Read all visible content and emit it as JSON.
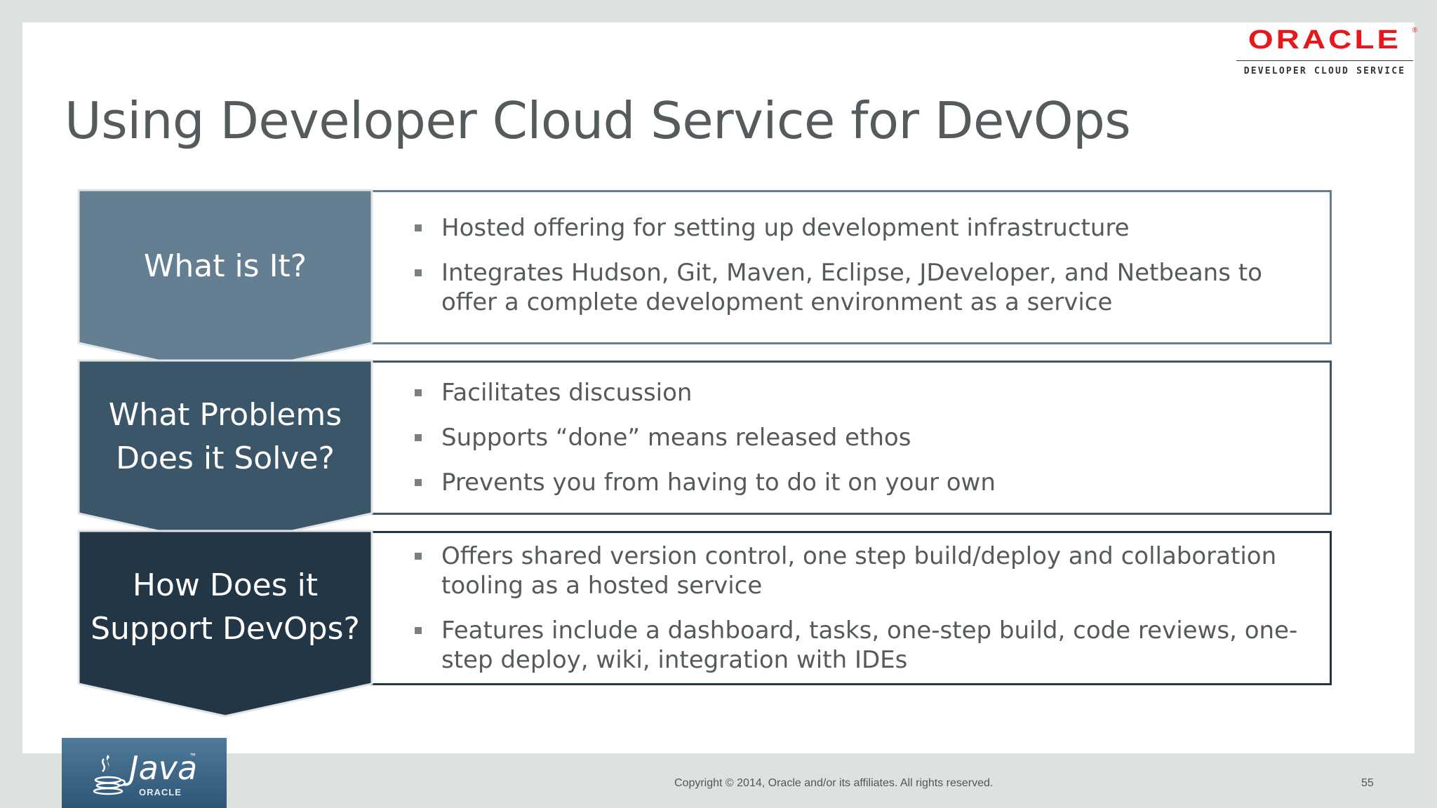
{
  "slide": {
    "title": "Using Developer Cloud Service for DevOps",
    "logo": {
      "brand": "ORACLE",
      "registered": "®",
      "subtitle": "DEVELOPER CLOUD SERVICE",
      "brand_color": "#e6171d"
    },
    "rows": [
      {
        "label": "What is It?",
        "color": "#647e92",
        "bullets": [
          "Hosted offering for setting up development infrastructure",
          "Integrates Hudson, Git, Maven, Eclipse, JDeveloper, and Netbeans to offer a complete development environment as a service"
        ]
      },
      {
        "label": "What Problems Does it Solve?",
        "color": "#3b5669",
        "bullets": [
          "Facilitates discussion",
          "Supports “done” means released ethos",
          "Prevents you from having to do it on your own"
        ]
      },
      {
        "label": "How Does it Support DevOps?",
        "color": "#233646",
        "bullets": [
          "Offers shared version control, one step build/deploy and collaboration tooling as a hosted service",
          "Features include a dashboard, tasks, one-step build, code reviews, one-step deploy, wiki, integration with IDEs"
        ]
      }
    ],
    "java_badge": {
      "word": "Java",
      "tm": "™",
      "oracle": "ORACLE",
      "icon": "java-cup-icon"
    },
    "footer": {
      "copyright": "Copyright © 2014, Oracle and/or its affiliates. All rights reserved.",
      "page_number": "55"
    }
  }
}
